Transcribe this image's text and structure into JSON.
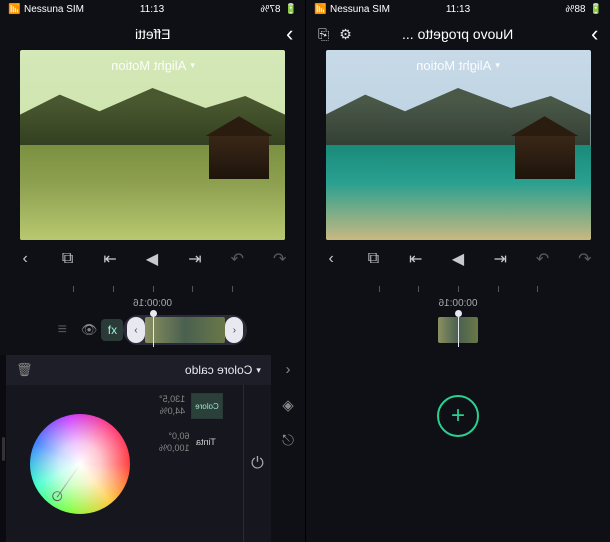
{
  "left": {
    "status": {
      "time": "11:13",
      "battery": "87%",
      "carrier": "Nessuna SIM"
    },
    "header": {
      "title": "Effetti"
    },
    "watermark": "Alight Motion",
    "timecode": "00:00:16",
    "panel": {
      "effect_name": "Colore caldo",
      "swatch_label": "Colore",
      "color_h": "130,5°",
      "color_s": "44,0%",
      "tint_label": "Tinta",
      "tint_a": "60,0°",
      "tint_b": "100,0%"
    }
  },
  "right": {
    "status": {
      "time": "11:13",
      "battery": "88%",
      "carrier": "Nessuna SIM"
    },
    "header": {
      "title": "Nuovo progetto ..."
    },
    "watermark": "Alight Motion",
    "timecode": "00:00:16"
  },
  "icons": {
    "play": "▶",
    "caret": "▾",
    "trash": "🗑",
    "eye": "👁",
    "power": "⏻",
    "gear": "⚙",
    "cast": "⎘",
    "undo": "↶",
    "redo": "↷",
    "prev": "⇤",
    "next": "⇥",
    "layers": "⧉",
    "menu": "≡",
    "diamond": "◈",
    "aspect": "⌷",
    "chev_l": "‹",
    "chev_r": "›",
    "plus": "+"
  }
}
